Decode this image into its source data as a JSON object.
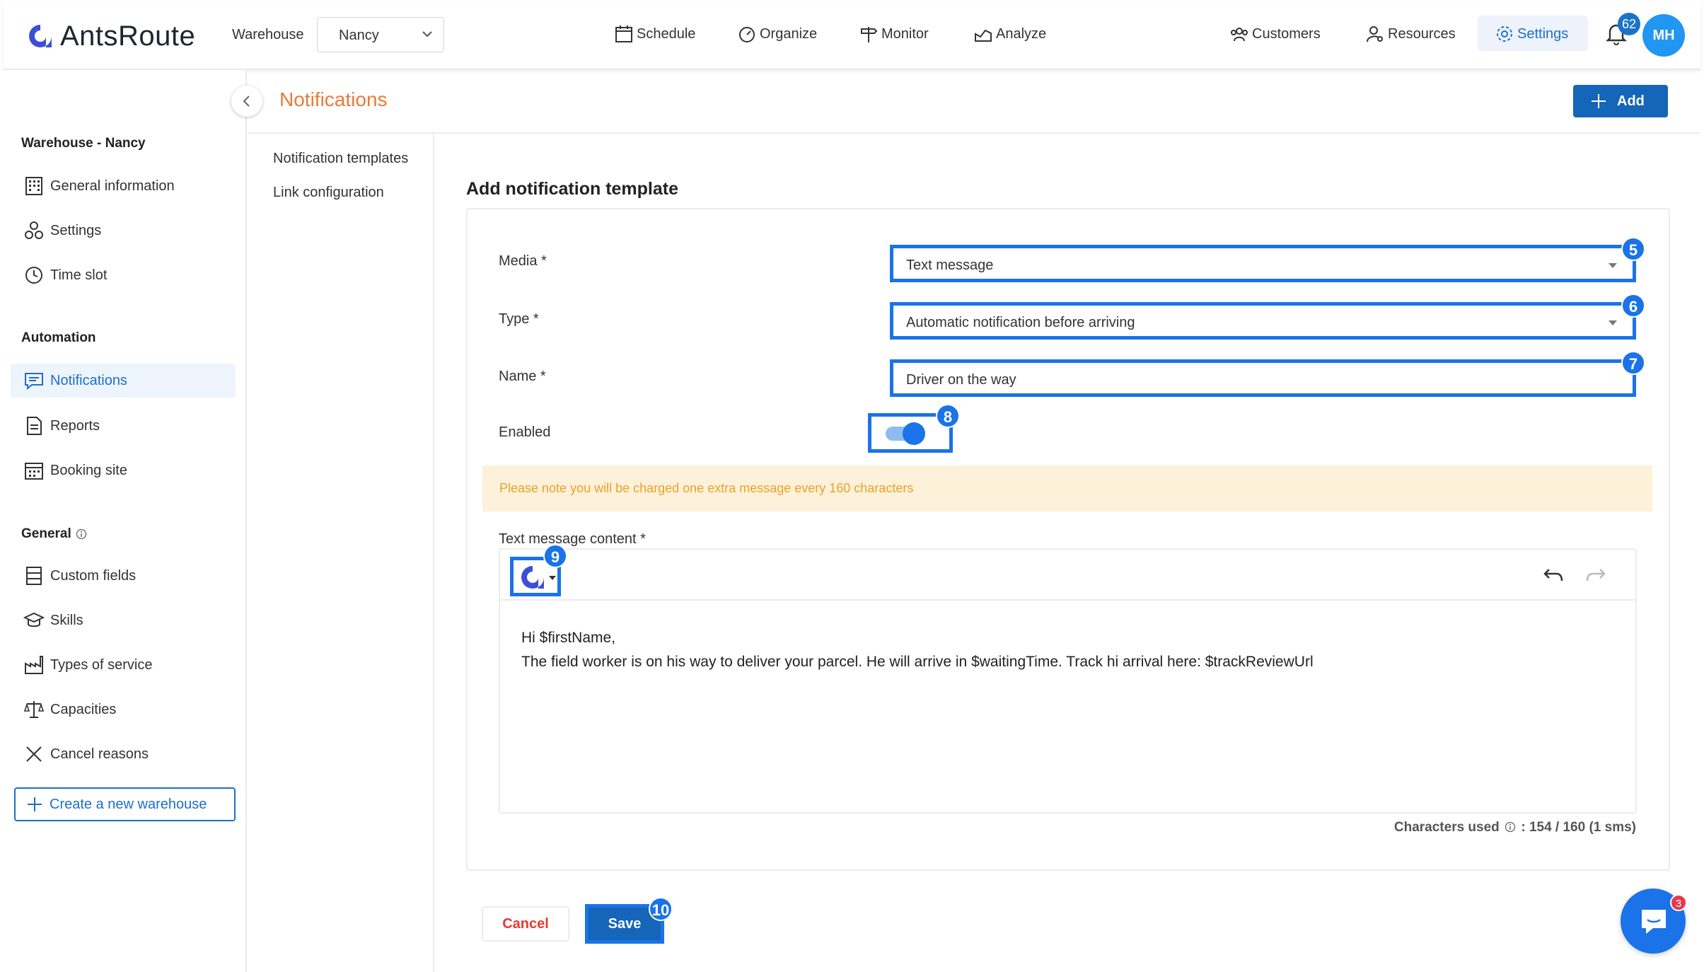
{
  "app": {
    "logo_text": "AntsRoute",
    "warehouse_label": "Warehouse",
    "warehouse_value": "Nancy"
  },
  "nav": {
    "schedule": "Schedule",
    "organize": "Organize",
    "monitor": "Monitor",
    "analyze": "Analyze",
    "customers": "Customers",
    "resources": "Resources",
    "settings": "Settings",
    "notifications_count": "62",
    "avatar_initials": "MH"
  },
  "sidebar": {
    "warehouse_heading": "Warehouse - Nancy",
    "warehouse_items": [
      "General information",
      "Settings",
      "Time slot"
    ],
    "automation_heading": "Automation",
    "automation_items": [
      "Notifications",
      "Reports",
      "Booking site"
    ],
    "general_heading": "General",
    "general_items": [
      "Custom fields",
      "Skills",
      "Types of service",
      "Capacities",
      "Cancel reasons"
    ],
    "create_label": "Create a new warehouse"
  },
  "subnav": {
    "items": [
      "Notification templates",
      "Link configuration"
    ]
  },
  "page": {
    "title": "Notifications",
    "add_label": "Add",
    "form_title": "Add notification template"
  },
  "form": {
    "media_label": "Media *",
    "media_value": "Text message",
    "type_label": "Type *",
    "type_value": "Automatic notification before arriving",
    "name_label": "Name *",
    "name_value": "Driver on the way",
    "enabled_label": "Enabled",
    "enabled": true,
    "note": "Please note you will be charged one extra message every 160 characters",
    "content_label": "Text message content *",
    "content_line1": "Hi $firstName,",
    "content_line2": "The field worker is on his way to deliver your parcel. He will arrive in $waitingTime. Track hi arrival here:  $trackReviewUrl",
    "chars_label": "Characters used",
    "chars_value": ": 154 / 160 (1 sms)",
    "cancel_label": "Cancel",
    "save_label": "Save"
  },
  "callouts": {
    "media": "5",
    "type": "6",
    "name": "7",
    "enabled": "8",
    "variable": "9",
    "save": "10"
  },
  "chat": {
    "badge": "3"
  },
  "colors": {
    "accent": "#1a73e8",
    "primary_button": "#1565b8",
    "title_orange": "#e87a38",
    "note_bg": "#fdf1d9",
    "note_text": "#e7a32a",
    "danger": "#e53935"
  }
}
